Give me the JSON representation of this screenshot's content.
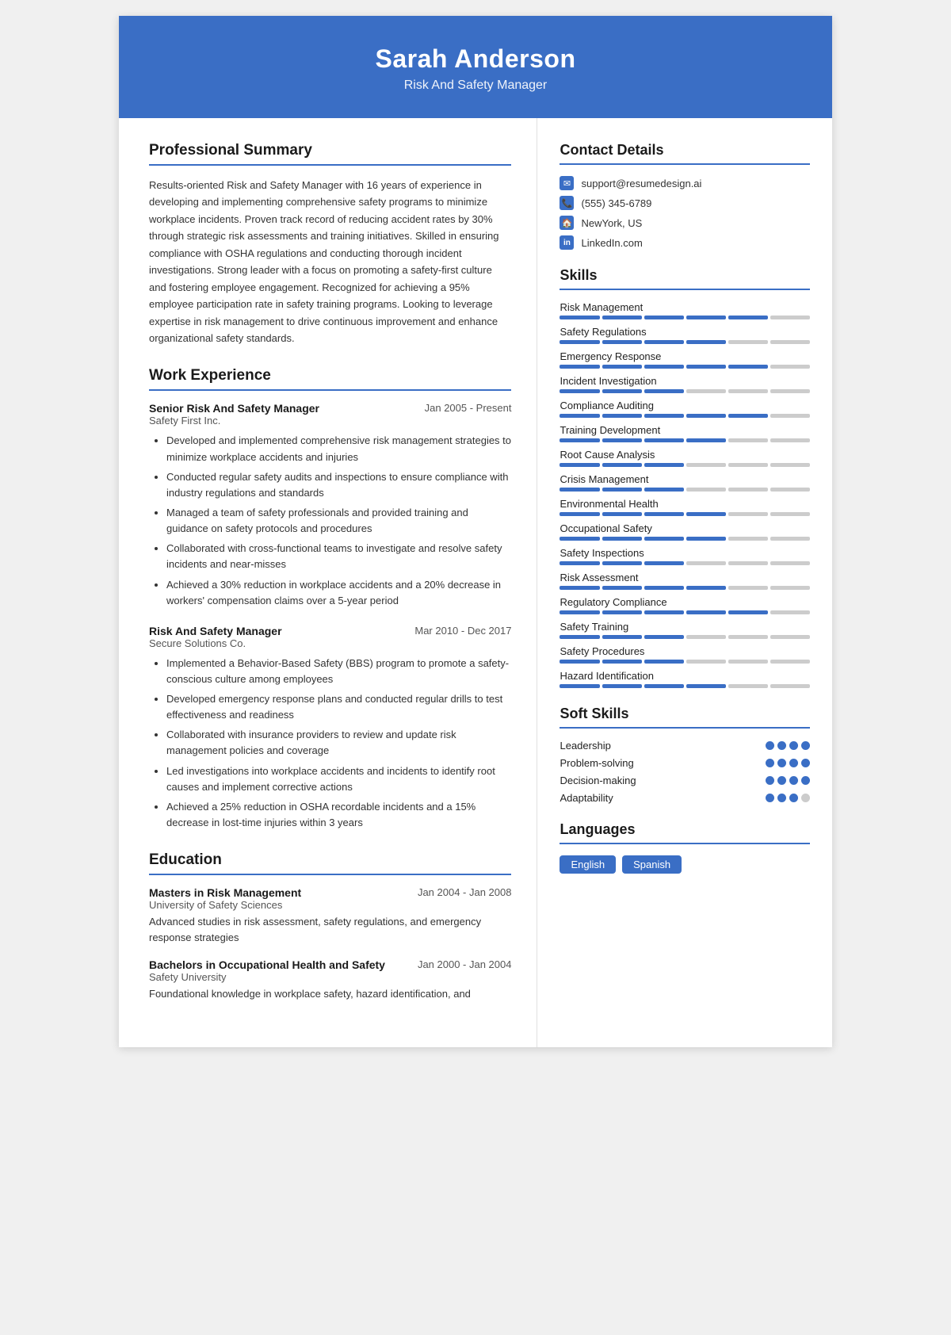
{
  "header": {
    "name": "Sarah Anderson",
    "title": "Risk And Safety Manager"
  },
  "summary": {
    "section_title": "Professional Summary",
    "text": "Results-oriented Risk and Safety Manager with 16 years of experience in developing and implementing comprehensive safety programs to minimize workplace incidents. Proven track record of reducing accident rates by 30% through strategic risk assessments and training initiatives. Skilled in ensuring compliance with OSHA regulations and conducting thorough incident investigations. Strong leader with a focus on promoting a safety-first culture and fostering employee engagement. Recognized for achieving a 95% employee participation rate in safety training programs. Looking to leverage expertise in risk management to drive continuous improvement and enhance organizational safety standards."
  },
  "experience": {
    "section_title": "Work Experience",
    "jobs": [
      {
        "title": "Senior Risk And Safety Manager",
        "company": "Safety First Inc.",
        "date": "Jan 2005 - Present",
        "bullets": [
          "Developed and implemented comprehensive risk management strategies to minimize workplace accidents and injuries",
          "Conducted regular safety audits and inspections to ensure compliance with industry regulations and standards",
          "Managed a team of safety professionals and provided training and guidance on safety protocols and procedures",
          "Collaborated with cross-functional teams to investigate and resolve safety incidents and near-misses",
          "Achieved a 30% reduction in workplace accidents and a 20% decrease in workers' compensation claims over a 5-year period"
        ]
      },
      {
        "title": "Risk And Safety Manager",
        "company": "Secure Solutions Co.",
        "date": "Mar 2010 - Dec 2017",
        "bullets": [
          "Implemented a Behavior-Based Safety (BBS) program to promote a safety-conscious culture among employees",
          "Developed emergency response plans and conducted regular drills to test effectiveness and readiness",
          "Collaborated with insurance providers to review and update risk management policies and coverage",
          "Led investigations into workplace accidents and incidents to identify root causes and implement corrective actions",
          "Achieved a 25% reduction in OSHA recordable incidents and a 15% decrease in lost-time injuries within 3 years"
        ]
      }
    ]
  },
  "education": {
    "section_title": "Education",
    "items": [
      {
        "degree": "Masters in Risk Management",
        "school": "University of Safety Sciences",
        "date": "Jan 2004 - Jan 2008",
        "desc": "Advanced studies in risk assessment, safety regulations, and emergency response strategies"
      },
      {
        "degree": "Bachelors in Occupational Health and Safety",
        "school": "Safety University",
        "date": "Jan 2000 - Jan 2004",
        "desc": "Foundational knowledge in workplace safety, hazard identification, and"
      }
    ]
  },
  "contact": {
    "section_title": "Contact Details",
    "items": [
      {
        "icon": "✉",
        "value": "support@resumedesign.ai"
      },
      {
        "icon": "📞",
        "value": "(555) 345-6789"
      },
      {
        "icon": "🏠",
        "value": "NewYork, US"
      },
      {
        "icon": "in",
        "value": "LinkedIn.com"
      }
    ]
  },
  "skills": {
    "section_title": "Skills",
    "items": [
      {
        "name": "Risk Management",
        "filled": 5,
        "total": 6
      },
      {
        "name": "Safety Regulations",
        "filled": 4,
        "total": 6
      },
      {
        "name": "Emergency Response",
        "filled": 5,
        "total": 6
      },
      {
        "name": "Incident Investigation",
        "filled": 3,
        "total": 6
      },
      {
        "name": "Compliance Auditing",
        "filled": 5,
        "total": 6
      },
      {
        "name": "Training Development",
        "filled": 4,
        "total": 6
      },
      {
        "name": "Root Cause Analysis",
        "filled": 3,
        "total": 6
      },
      {
        "name": "Crisis Management",
        "filled": 3,
        "total": 6
      },
      {
        "name": "Environmental Health",
        "filled": 4,
        "total": 6
      },
      {
        "name": "Occupational Safety",
        "filled": 4,
        "total": 6
      },
      {
        "name": "Safety Inspections",
        "filled": 3,
        "total": 6
      },
      {
        "name": "Risk Assessment",
        "filled": 4,
        "total": 6
      },
      {
        "name": "Regulatory Compliance",
        "filled": 5,
        "total": 6
      },
      {
        "name": "Safety Training",
        "filled": 3,
        "total": 6
      },
      {
        "name": "Safety Procedures",
        "filled": 3,
        "total": 6
      },
      {
        "name": "Hazard Identification",
        "filled": 4,
        "total": 6
      }
    ]
  },
  "soft_skills": {
    "section_title": "Soft Skills",
    "items": [
      {
        "name": "Leadership",
        "filled": 4,
        "total": 4
      },
      {
        "name": "Problem-solving",
        "filled": 4,
        "total": 4
      },
      {
        "name": "Decision-making",
        "filled": 4,
        "total": 4
      },
      {
        "name": "Adaptability",
        "filled": 3,
        "total": 4
      }
    ]
  },
  "languages": {
    "section_title": "Languages",
    "items": [
      "English",
      "Spanish"
    ]
  }
}
